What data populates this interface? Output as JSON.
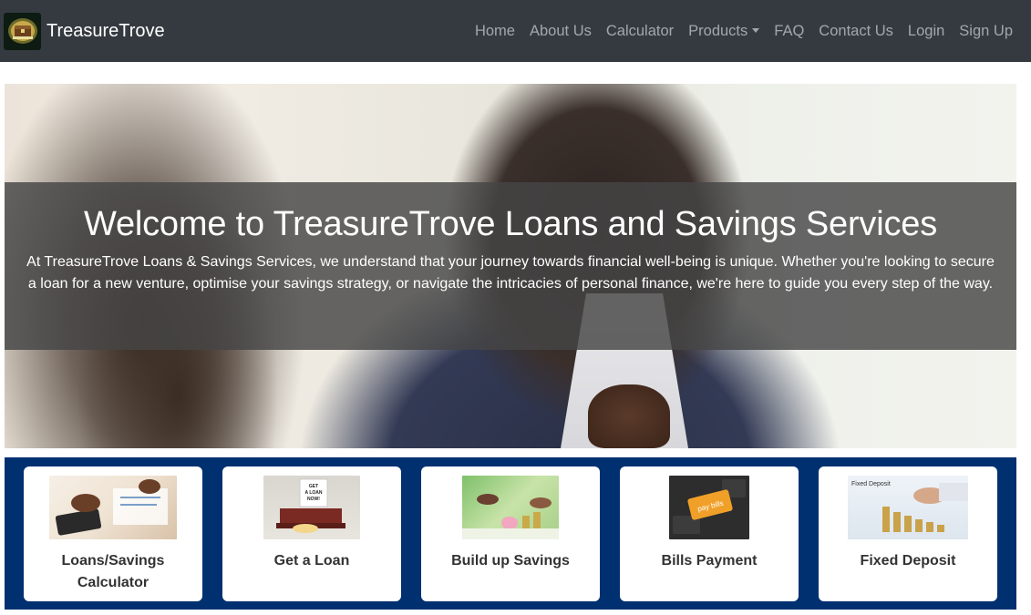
{
  "brand": {
    "name": "TreasureTrove",
    "logo_icon": "treasure-chest-logo"
  },
  "nav": [
    {
      "label": "Home"
    },
    {
      "label": "About Us"
    },
    {
      "label": "Calculator"
    },
    {
      "label": "Products",
      "dropdown": true
    },
    {
      "label": "FAQ"
    },
    {
      "label": "Contact Us"
    },
    {
      "label": "Login"
    },
    {
      "label": "Sign Up"
    }
  ],
  "hero": {
    "title": "Welcome to TreasureTrove Loans and Savings Services",
    "text": "At TreasureTrove Loans & Savings Services, we understand that your journey towards financial well-being is unique. Whether you're looking to secure a loan for a new venture, optimise your savings strategy, or navigate the intricacies of personal finance, we're here to guide you every step of the way."
  },
  "services": [
    {
      "label": "Loans/Savings Calculator",
      "image": "calculator-desk-photo"
    },
    {
      "label": "Get a Loan",
      "image": "get-a-loan-note-photo",
      "image_text": "GET A LOAN NOW!"
    },
    {
      "label": "Build up Savings",
      "image": "piggy-bank-savings-photo"
    },
    {
      "label": "Bills Payment",
      "image": "pay-bills-key-photo",
      "image_text": "pay bills"
    },
    {
      "label": "Fixed Deposit",
      "image": "coin-stacks-photo",
      "image_text": "Fixed Deposit"
    }
  ],
  "colors": {
    "navbar_bg": "#343a40",
    "services_bg": "#003070",
    "overlay": "rgba(70,70,70,0.82)"
  }
}
